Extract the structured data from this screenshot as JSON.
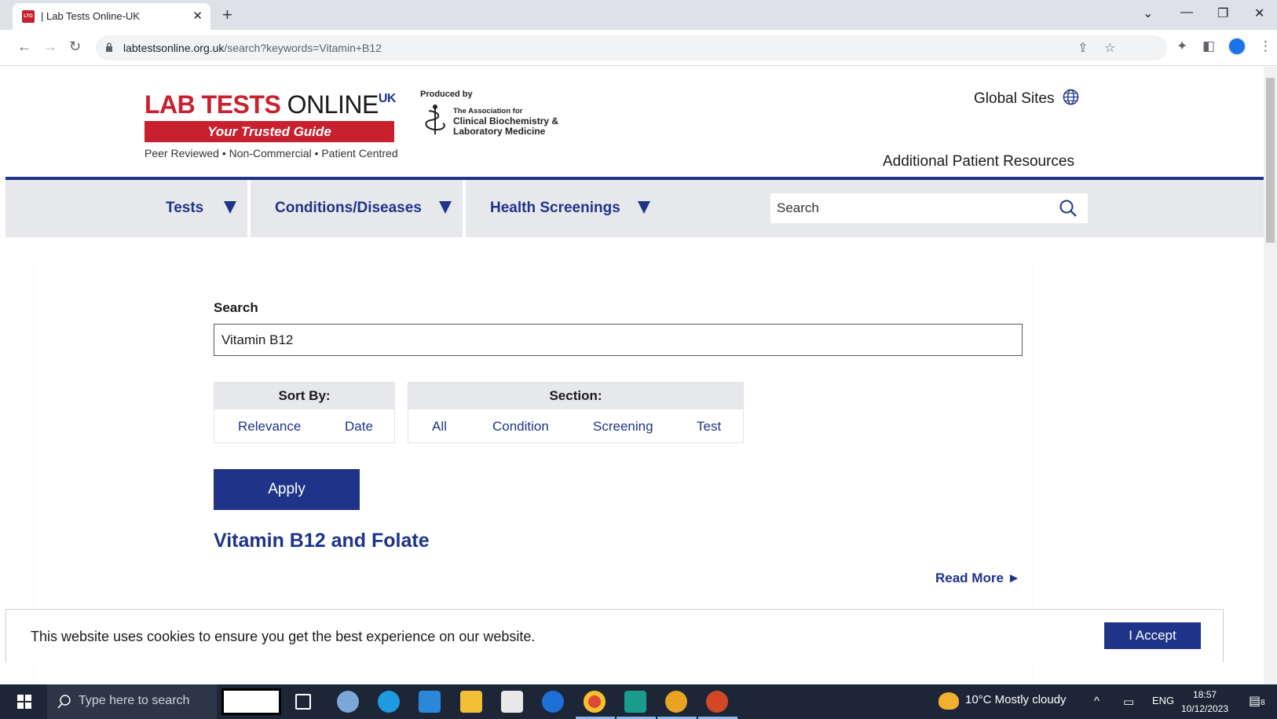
{
  "browser": {
    "tab_title": "| Lab Tests Online-UK",
    "favicon_text": "LTO",
    "url_domain": "labtestsonline.org.uk",
    "url_path": "/search?keywords=Vitamin+B12"
  },
  "header": {
    "logo_lab_tests": "LAB TESTS",
    "logo_online": "ONLINE",
    "logo_uk": "UK",
    "tagline": "Your Trusted Guide",
    "subline": "Peer Reviewed • Non-Commercial • Patient Centred",
    "produced_by": "Produced by",
    "acb_line1": "The Association for",
    "acb_line2": "Clinical Biochemistry &",
    "acb_line3": "Laboratory Medicine",
    "global_sites": "Global Sites",
    "additional_resources": "Additional Patient Resources"
  },
  "nav": {
    "tests": "Tests",
    "conditions": "Conditions/Diseases",
    "screenings": "Health Screenings",
    "search_placeholder": "Search"
  },
  "search": {
    "label": "Search",
    "value": "Vitamin B12",
    "sort_by": {
      "title": "Sort By:",
      "options": [
        "Relevance",
        "Date"
      ]
    },
    "section": {
      "title": "Section:",
      "options": [
        "All",
        "Condition",
        "Screening",
        "Test"
      ]
    },
    "apply_label": "Apply"
  },
  "results": [
    {
      "title": "Vitamin B12 and Folate",
      "read_more": "Read More ►"
    }
  ],
  "cookie": {
    "text": "This website uses cookies to ensure you get the best experience on our website.",
    "accept_label": "I Accept"
  },
  "taskbar": {
    "search_placeholder": "Type here to search",
    "weather": "10°C  Mostly cloudy",
    "language": "ENG",
    "time": "18:57",
    "date": "10/12/2023",
    "notifications": "8"
  },
  "colors": {
    "brand_red": "#c8202f",
    "brand_navy": "#1f3489",
    "nav_bg": "#e7e8ec"
  }
}
